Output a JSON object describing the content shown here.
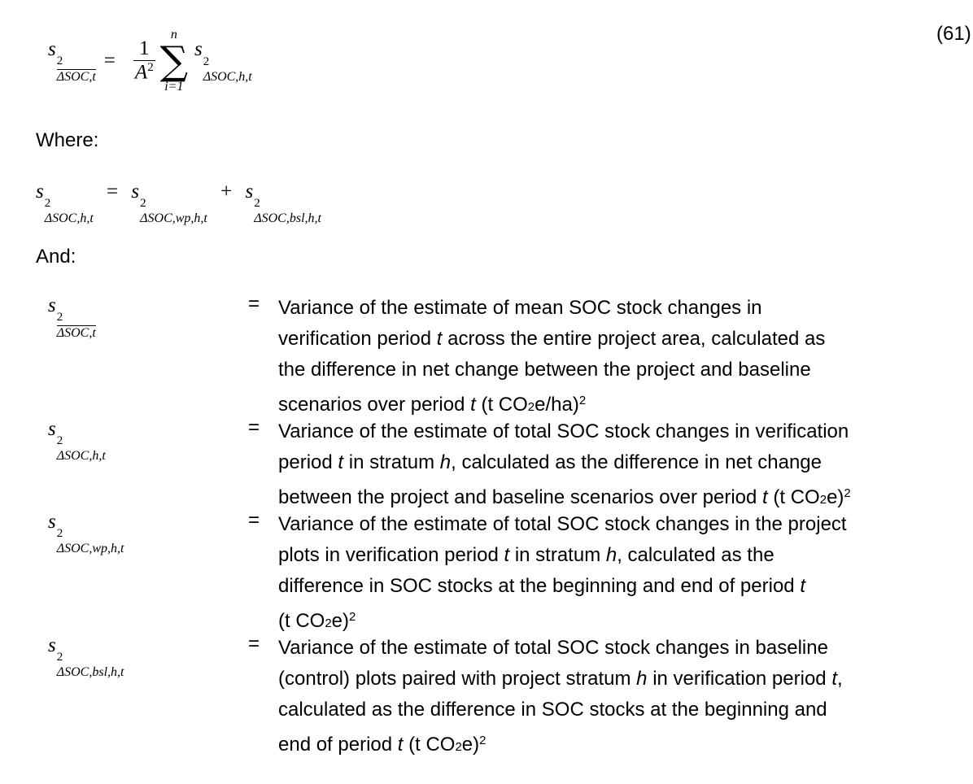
{
  "equation_main": {
    "lhs_sub": "ΔSOC,t",
    "equals": "=",
    "frac_num": "1",
    "frac_den": "A",
    "frac_den_exp": "2",
    "sum_top": "n",
    "sum_symbol": "∑",
    "sum_bottom": "i=1",
    "rhs_sub": "ΔSOC,h,t",
    "number": "(61)"
  },
  "where_label": "Where:",
  "equation_second": {
    "lhs_sub": "ΔSOC,h,t",
    "equals": "=",
    "term1_sub": "ΔSOC,wp,h,t",
    "plus": "+",
    "term2_sub": "ΔSOC,bsl,h,t"
  },
  "and_label": "And:",
  "symbol_base": "s",
  "symbol_exp": "2",
  "definitions": [
    {
      "sub": "ΔSOC,t",
      "overline": true,
      "equals": "=",
      "lines": [
        "Variance of the estimate of mean SOC stock changes in",
        "verification period t across the entire project area, calculated as",
        "the difference in net change between the project and baseline",
        "scenarios over period t (t CO2e/ha)2"
      ]
    },
    {
      "sub": "ΔSOC,h,t",
      "overline": false,
      "equals": "=",
      "lines": [
        "Variance of the estimate of total SOC stock changes in verification",
        "period t in stratum h, calculated as the difference in net change",
        "between the project and baseline scenarios over period t (t CO2e)2"
      ]
    },
    {
      "sub": "ΔSOC,wp,h,t",
      "overline": false,
      "equals": "=",
      "lines": [
        "Variance of the estimate of total SOC stock changes in the project",
        "plots in verification period t in stratum h, calculated as the",
        "difference in SOC stocks at the beginning and end of period t",
        "(t CO2e)2"
      ]
    },
    {
      "sub": "ΔSOC,bsl,h,t",
      "overline": false,
      "equals": "=",
      "lines": [
        "Variance of the estimate of total SOC stock changes in baseline",
        "(control) plots paired with project stratum h in verification period t,",
        "calculated as the difference in SOC stocks at the beginning and",
        "end of period t (t CO2e)2"
      ]
    }
  ]
}
